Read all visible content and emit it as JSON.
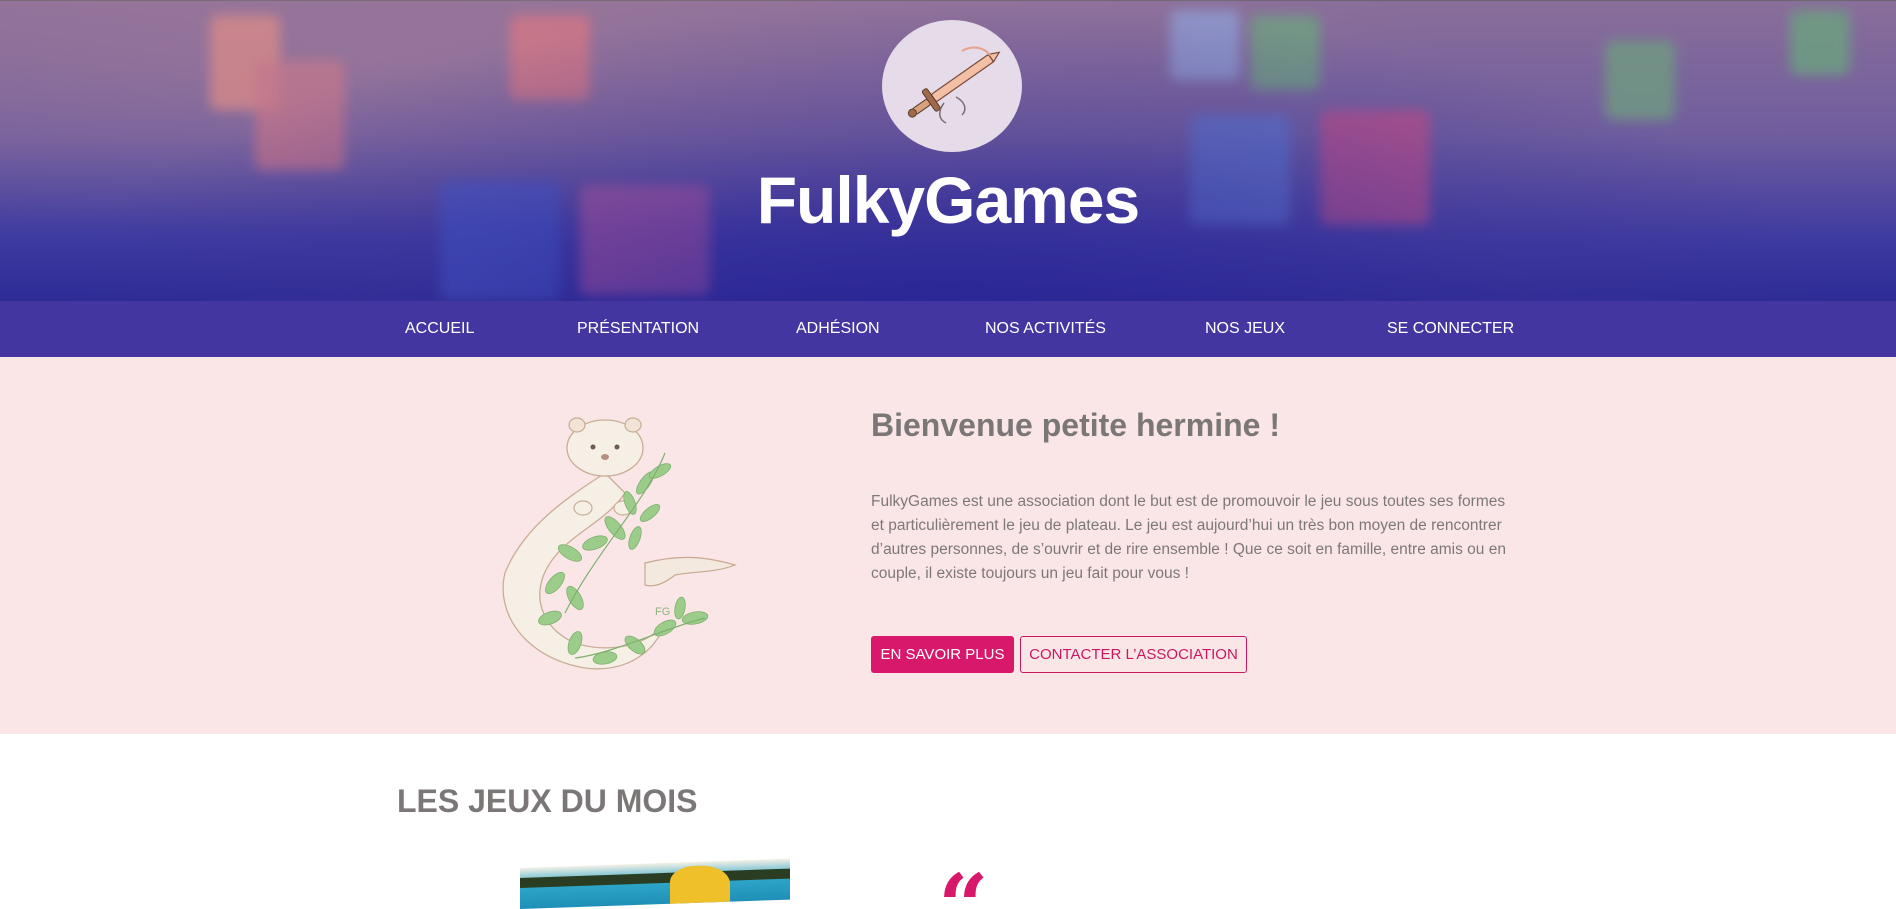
{
  "header": {
    "site_title": "FulkyGames",
    "logo_icon": "sword-icon"
  },
  "nav": {
    "items": [
      {
        "label": "ACCUEIL"
      },
      {
        "label": "PRÉSENTATION"
      },
      {
        "label": "ADHÉSION"
      },
      {
        "label": "NOS ACTIVITÉS"
      },
      {
        "label": "NOS JEUX"
      },
      {
        "label": "SE CONNECTER"
      }
    ]
  },
  "welcome": {
    "title": "Bienvenue petite hermine !",
    "text": "FulkyGames est une association dont le but est de promouvoir le jeu sous toutes ses formes et particulièrement le jeu de plateau. Le jeu est aujourd’hui un très bon moyen de rencontrer d’autres personnes, de s’ouvrir et de rire ensemble ! Que ce soit en famille, entre amis ou en couple, il existe toujours un jeu fait pour vous !",
    "image_icon": "ermine-mascot-icon",
    "mascot_initials": "FG",
    "primary_button": "EN SAVOIR PLUS",
    "secondary_button": "CONTACTER L’ASSOCIATION"
  },
  "games_of_month": {
    "title": "LES JEUX DU MOIS",
    "quote_mark": "“"
  },
  "colors": {
    "nav_bg": "#4436a0",
    "accent": "#d8196b",
    "welcome_bg": "#fbe6e7",
    "heading_text": "#7b7777"
  }
}
